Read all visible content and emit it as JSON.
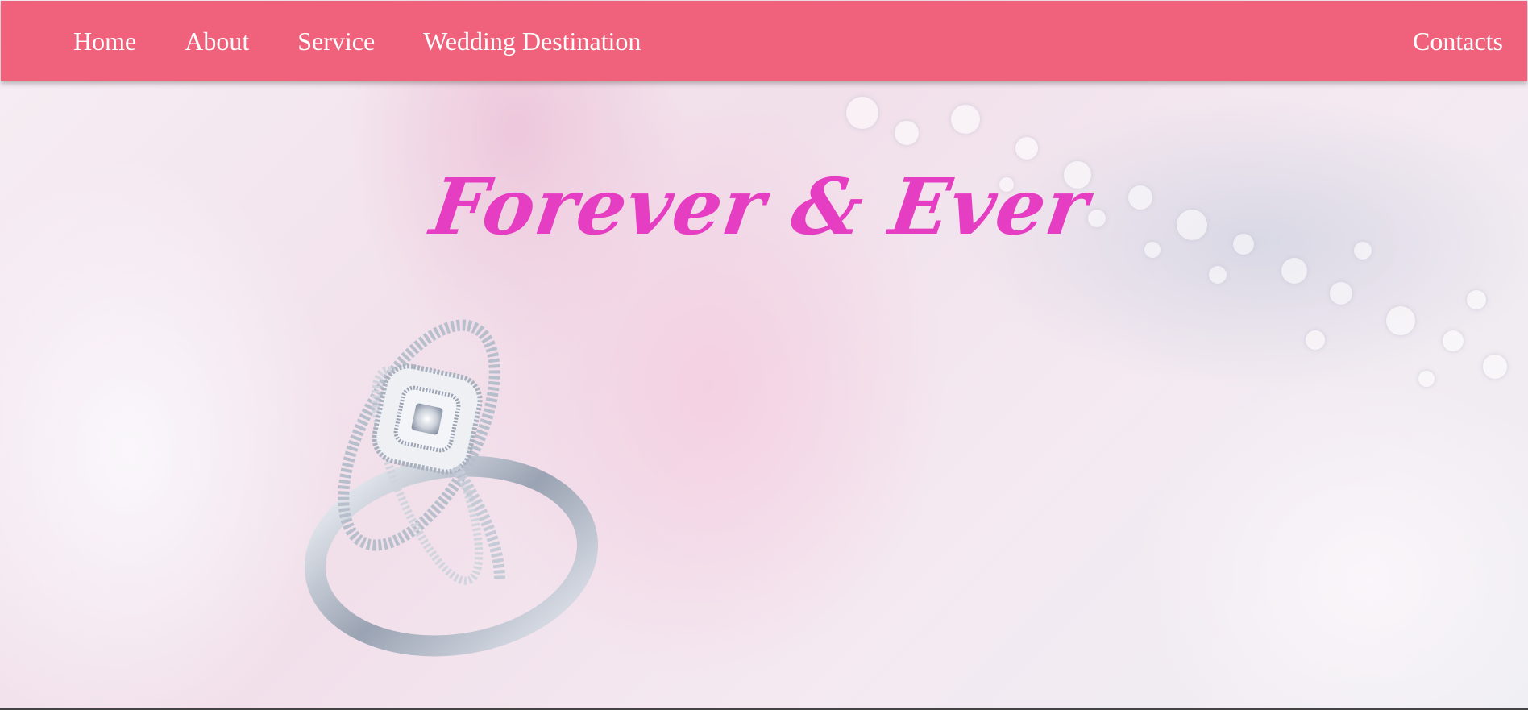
{
  "nav": {
    "items": [
      {
        "label": "Home"
      },
      {
        "label": "About"
      },
      {
        "label": "Service"
      },
      {
        "label": "Wedding Destination"
      }
    ],
    "contacts_label": "Contacts"
  },
  "hero": {
    "title": "Forever & Ever",
    "image_subject": "wedding-rings-image"
  },
  "colors": {
    "navbar": "#f0627c",
    "nav_text": "#ffffff",
    "title": "#e63ec2",
    "background": "#f3eef4"
  }
}
